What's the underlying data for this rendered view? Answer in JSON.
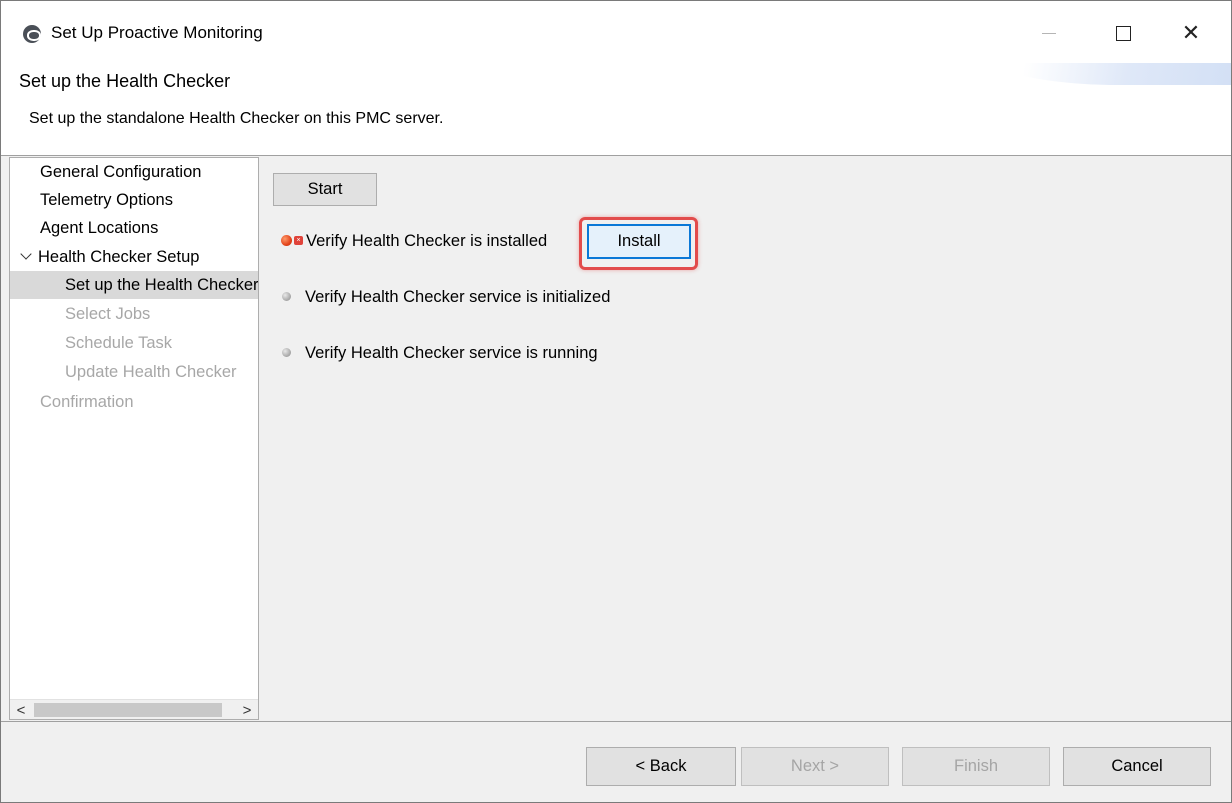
{
  "window": {
    "title": "Set Up Proactive Monitoring",
    "icon": "app-logo-icon",
    "controls": [
      "minimize-icon",
      "maximize-icon",
      "close-icon"
    ],
    "close_glyph": "✕"
  },
  "header": {
    "title": "Set up the Health Checker",
    "description": "Set up the standalone Health Checker on this PMC server."
  },
  "nav": {
    "items": [
      {
        "label": "General Configuration",
        "state": "normal"
      },
      {
        "label": "Telemetry Options",
        "state": "normal"
      },
      {
        "label": "Agent Locations",
        "state": "normal"
      },
      {
        "label": "Health Checker Setup",
        "state": "expanded"
      },
      {
        "label": "Set up the Health Checker",
        "state": "selected"
      },
      {
        "label": "Select Jobs",
        "state": "disabled"
      },
      {
        "label": "Schedule Task",
        "state": "disabled"
      },
      {
        "label": "Update Health Checker",
        "state": "disabled"
      },
      {
        "label": "Confirmation",
        "state": "disabled"
      }
    ],
    "scroll_left": "<",
    "scroll_right": ">"
  },
  "main": {
    "start_label": "Start",
    "steps": [
      {
        "label": "Verify Health Checker is installed",
        "status": "error"
      },
      {
        "label": "Verify Health Checker service is initialized",
        "status": "pending"
      },
      {
        "label": "Verify Health Checker service is running",
        "status": "pending"
      }
    ],
    "install_label": "Install",
    "error_badge": "×"
  },
  "footer": {
    "back_label": "< Back",
    "next_label": "Next >",
    "finish_label": "Finish",
    "cancel_label": "Cancel"
  },
  "colors": {
    "highlight": "#e24c4c",
    "focus": "#0a78d7",
    "error": "#e3441b"
  }
}
